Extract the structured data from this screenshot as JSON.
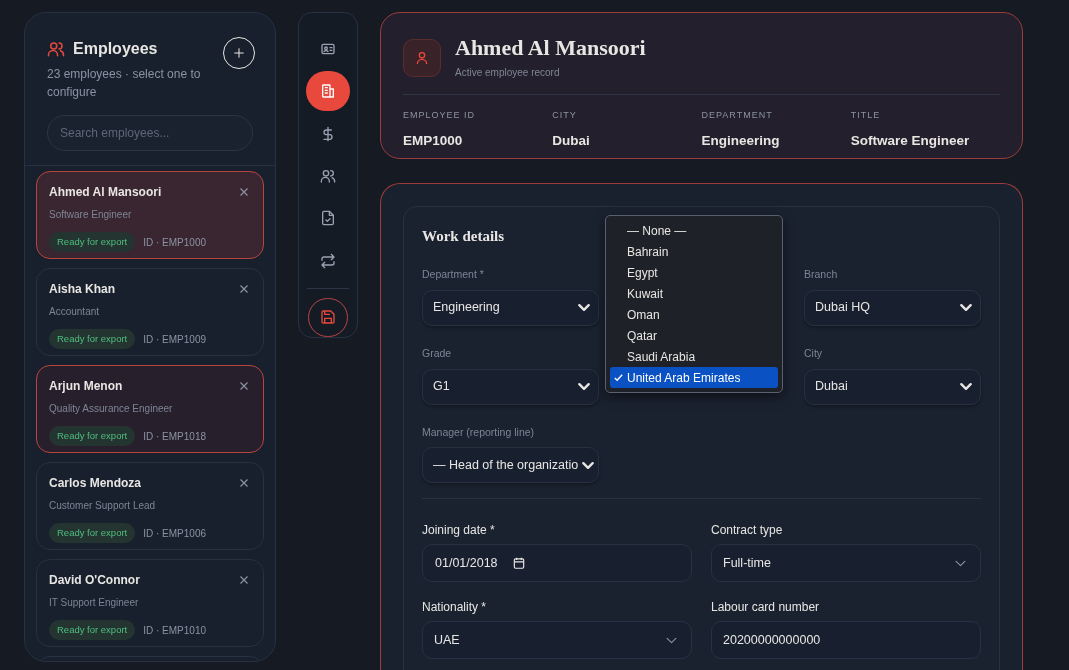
{
  "sidebar": {
    "title": "Employees",
    "subtitle": "23 employees · select one to configure",
    "search": {
      "placeholder": "Search employees..."
    },
    "employees": [
      {
        "name": "Ahmed Al Mansoori",
        "title": "Software Engineer",
        "status": "Ready for export",
        "id": "ID · EMP1000",
        "selected": true,
        "flagged": true
      },
      {
        "name": "Aisha Khan",
        "title": "Accountant",
        "status": "Ready for export",
        "id": "ID · EMP1009",
        "selected": false,
        "flagged": false
      },
      {
        "name": "Arjun Menon",
        "title": "Quality Assurance Engineer",
        "status": "Ready for export",
        "id": "ID · EMP1018",
        "selected": false,
        "flagged": true
      },
      {
        "name": "Carlos Mendoza",
        "title": "Customer Support Lead",
        "status": "Ready for export",
        "id": "ID · EMP1006",
        "selected": false,
        "flagged": false
      },
      {
        "name": "David O'Connor",
        "title": "IT Support Engineer",
        "status": "Ready for export",
        "id": "ID · EMP1010",
        "selected": false,
        "flagged": false
      }
    ]
  },
  "nav_rail": {
    "items": [
      {
        "kind": "id-card",
        "selected": false
      },
      {
        "kind": "building",
        "selected": true
      },
      {
        "kind": "dollar",
        "selected": false
      },
      {
        "kind": "users",
        "selected": false
      },
      {
        "kind": "file",
        "selected": false
      },
      {
        "kind": "repeat",
        "selected": false
      }
    ]
  },
  "header": {
    "name": "Ahmed Al Mansoori",
    "subtitle": "Active employee record",
    "fields": [
      {
        "label": "EMPLOYEE ID",
        "value": "EMP1000"
      },
      {
        "label": "CITY",
        "value": "Dubai"
      },
      {
        "label": "DEPARTMENT",
        "value": "Engineering"
      },
      {
        "label": "TITLE",
        "value": "Software Engineer"
      }
    ]
  },
  "work_details": {
    "title": "Work details",
    "fields": [
      {
        "label": "Department *",
        "value": "Engineering"
      },
      {
        "label": "Branch",
        "value": "Dubai HQ"
      },
      {
        "label": "Grade",
        "value": "G1"
      },
      {
        "label": "City",
        "value": "Dubai"
      },
      {
        "label": "Manager (reporting line)",
        "value": "— Head of the organizatio"
      }
    ],
    "open_dropdown": {
      "options": [
        {
          "label": "— None —",
          "selected": false
        },
        {
          "label": "Bahrain",
          "selected": false
        },
        {
          "label": "Egypt",
          "selected": false
        },
        {
          "label": "Kuwait",
          "selected": false
        },
        {
          "label": "Oman",
          "selected": false
        },
        {
          "label": "Qatar",
          "selected": false
        },
        {
          "label": "Saudi Arabia",
          "selected": false
        },
        {
          "label": "United Arab Emirates",
          "selected": true
        }
      ]
    }
  },
  "employment": {
    "fields": [
      {
        "label": "Joining date *",
        "value": "01/01/2018",
        "kind": "date"
      },
      {
        "label": "Contract type",
        "value": "Full-time",
        "kind": "picker"
      },
      {
        "label": "Nationality *",
        "value": "UAE",
        "kind": "picker"
      },
      {
        "label": "Labour card number",
        "value": "20200000000000",
        "kind": "text"
      }
    ]
  }
}
